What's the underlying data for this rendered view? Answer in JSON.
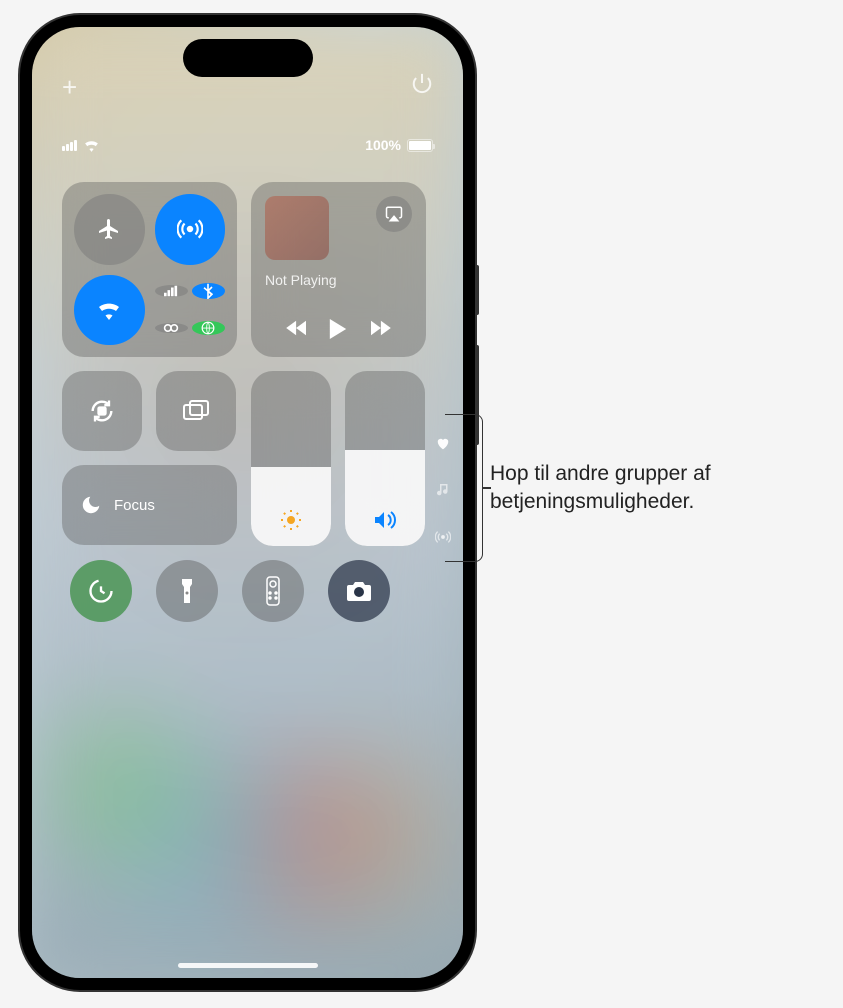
{
  "status": {
    "battery_pct": "100%"
  },
  "media": {
    "now_playing": "Not Playing"
  },
  "focus": {
    "label": "Focus"
  },
  "callout": {
    "text": "Hop til andre grupper af betjeningsmuligheder."
  },
  "icons": {
    "plus": "+",
    "airplane": "airplane-icon",
    "airdrop": "airdrop-icon",
    "wifi": "wifi-icon",
    "cellular": "cellular-icon",
    "bluetooth": "bluetooth-icon",
    "hotspot": "hotspot-icon",
    "vpn": "vpn-icon"
  }
}
